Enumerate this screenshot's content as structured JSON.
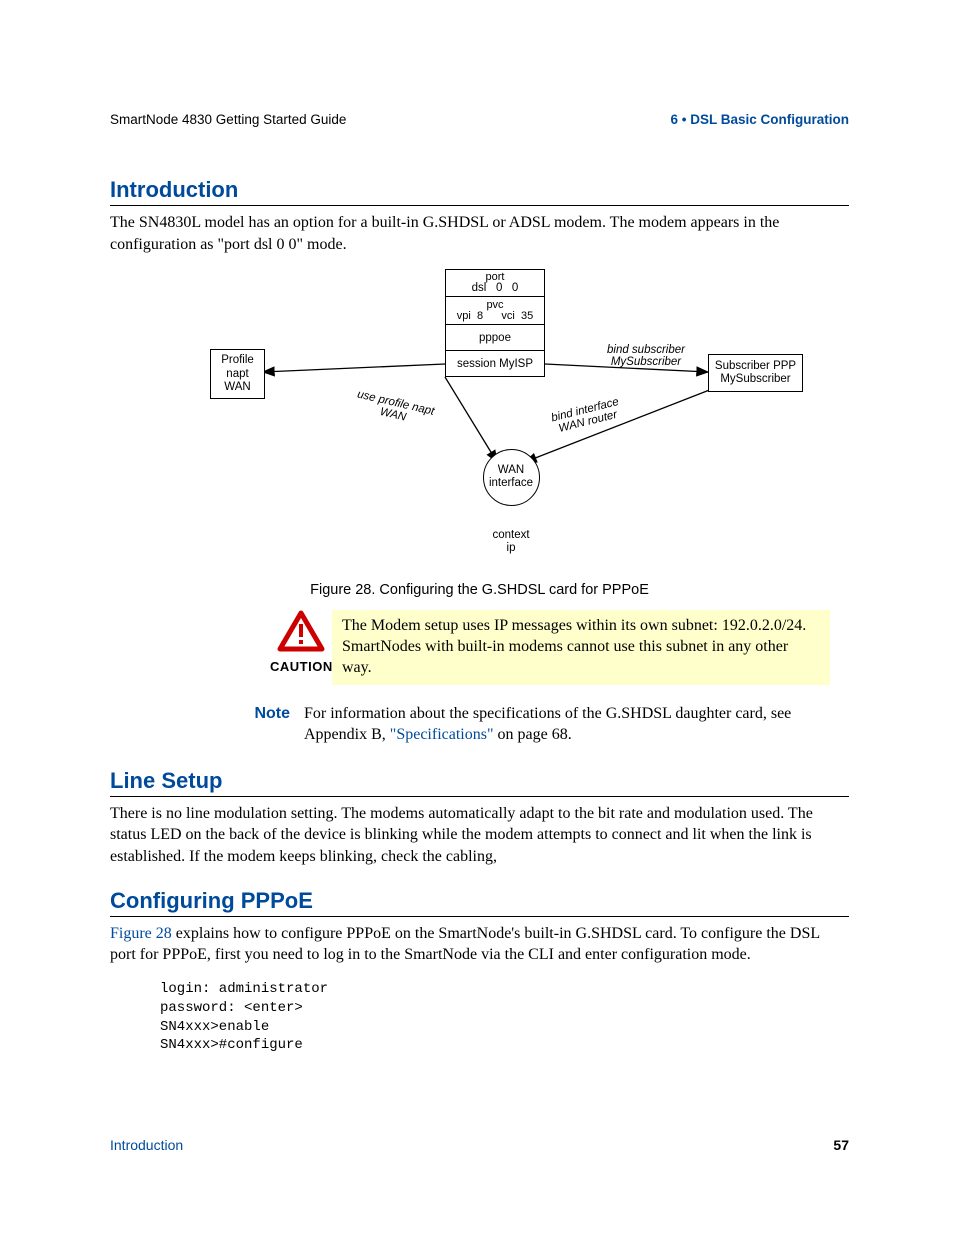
{
  "header": {
    "left": "SmartNode 4830 Getting Started Guide",
    "right": "6 • DSL Basic Configuration"
  },
  "sections": {
    "intro": {
      "title": "Introduction",
      "body": "The SN4830L  model has an option for a built-in G.SHDSL or ADSL modem. The modem appears in the configuration as \"port dsl 0 0\" mode."
    },
    "line": {
      "title": "Line Setup",
      "body": "There is no line modulation setting. The modems automatically adapt to the bit rate and modulation used. The status LED on the back of the device is blinking while the modem attempts to connect and lit when the link is established. If the modem keeps blinking, check the cabling,"
    },
    "pppoe": {
      "title": "Configuring PPPoE",
      "body_pre": " explains how to configure PPPoE on the SmartNode's built-in G.SHDSL card. To configure the DSL port for PPPoE, first you need to log in to the SmartNode via the CLI and enter configuration mode.",
      "xref": "Figure 28",
      "code": "login: administrator\npassword: <enter>\nSN4xxx>enable\nSN4xxx>#configure"
    }
  },
  "figure": {
    "caption": "Figure 28. Configuring the G.SHDSL card for PPPoE",
    "stack": {
      "port_top": "port",
      "port_bottom": "dsl   0   0",
      "pvc_top": "pvc",
      "pvc_bottom": "vpi  8      vci  35",
      "pppoe": "pppoe",
      "session": "session MyISP"
    },
    "left_box": "Profile\nnapt\nWAN",
    "right_box": "Subscriber PPP\nMySubscriber",
    "arrow_labels": {
      "use_profile": "use profile napt\nWAN",
      "bind_subscriber": "bind subscriber\nMySubscriber",
      "bind_interface": "bind interface\nWAN router"
    },
    "wan_label": "WAN\ninterface",
    "context_label": "context\nip"
  },
  "caution": {
    "label": "CAUTION",
    "text": "The Modem setup uses IP messages within its own subnet: 192.0.2.0/24. SmartNodes with built-in modems cannot use this subnet in any other way."
  },
  "note": {
    "label": "Note",
    "text_pre": "For information about the specifications of the G.SHDSL daughter card, see Appendix B, ",
    "link": "\"Specifications\"",
    "text_post": " on page 68."
  },
  "footer": {
    "left": "Introduction",
    "right": "57"
  }
}
